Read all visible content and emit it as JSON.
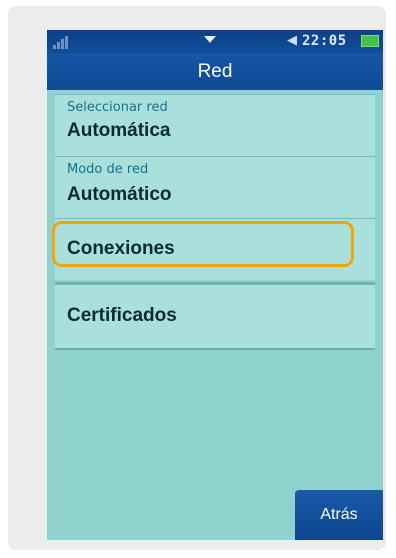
{
  "status_bar": {
    "time": "22:05",
    "icons": [
      "signal-icon",
      "notification-arrow-icon",
      "speaker-icon",
      "battery-icon"
    ]
  },
  "header": {
    "title": "Red"
  },
  "list": {
    "items": [
      {
        "label": "Seleccionar red",
        "value": "Automática"
      },
      {
        "label": "Modo de red",
        "value": "Automático"
      },
      {
        "value": "Conexiones"
      },
      {
        "value": "Certificados"
      }
    ]
  },
  "softkeys": {
    "back_label": "Atrás"
  },
  "colors": {
    "title_bar": "#0e4a96",
    "list_background": "#a9e0db",
    "highlight": "#f0a50c"
  }
}
